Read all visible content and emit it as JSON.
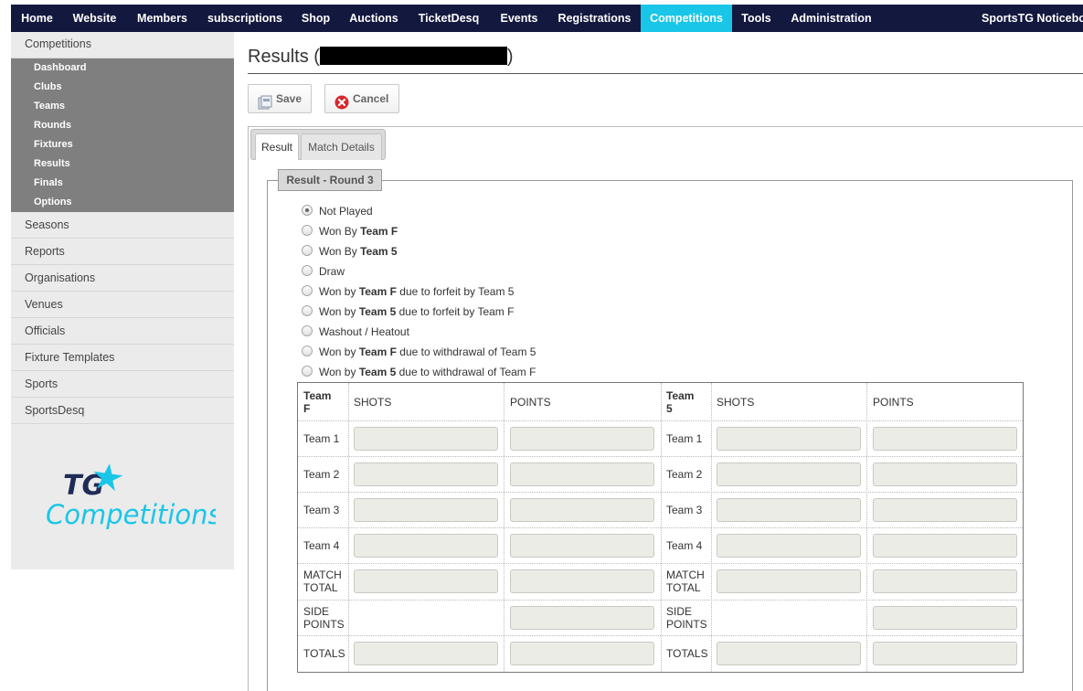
{
  "nav": {
    "items": [
      "Home",
      "Website",
      "Members",
      "subscriptions",
      "Shop",
      "Auctions",
      "TicketDesq",
      "Events",
      "Registrations",
      "Competitions",
      "Tools",
      "Administration"
    ],
    "active": "Competitions",
    "right_label": "SportsTG Noticeboard",
    "active_color": "#19c6e8",
    "bar_color": "#13183f"
  },
  "sidebar": {
    "section_title": "Competitions",
    "sub_items": [
      "Dashboard",
      "Clubs",
      "Teams",
      "Rounds",
      "Fixtures",
      "Results",
      "Finals",
      "Options"
    ],
    "items": [
      "Seasons",
      "Reports",
      "Organisations",
      "Venues",
      "Officials",
      "Fixture Templates",
      "Sports",
      "SportsDesq"
    ],
    "logo_line1": "TG",
    "logo_line2": "Competitions"
  },
  "page": {
    "title_prefix": "Results (",
    "title_suffix": ")",
    "save_label": "Save",
    "cancel_label": "Cancel"
  },
  "tabs": [
    "Result",
    "Match Details"
  ],
  "fieldset_legend": "Result - Round 3",
  "result_options": [
    {
      "pre": "Not Played",
      "team": "",
      "post": "",
      "checked": true
    },
    {
      "pre": "Won By ",
      "team": "Team F",
      "post": "",
      "checked": false
    },
    {
      "pre": "Won By ",
      "team": "Team 5",
      "post": "",
      "checked": false
    },
    {
      "pre": "Draw",
      "team": "",
      "post": "",
      "checked": false
    },
    {
      "pre": "Won by ",
      "team": "Team F",
      "post": " due to forfeit by Team 5",
      "checked": false
    },
    {
      "pre": "Won by ",
      "team": "Team 5",
      "post": " due to forfeit by Team F",
      "checked": false
    },
    {
      "pre": "Washout / Heatout",
      "team": "",
      "post": "",
      "checked": false
    },
    {
      "pre": "Won by ",
      "team": "Team F",
      "post": " due to withdrawal of Team 5",
      "checked": false
    },
    {
      "pre": "Won by ",
      "team": "Team 5",
      "post": " due to withdrawal of Team F",
      "checked": false
    }
  ],
  "score_table": {
    "home_team": "Team F",
    "away_team": "Team 5",
    "col_shots": "SHOTS",
    "col_points": "POINTS",
    "rows": [
      {
        "label": "Team 1",
        "shots": true
      },
      {
        "label": "Team 2",
        "shots": true
      },
      {
        "label": "Team 3",
        "shots": true
      },
      {
        "label": "Team 4",
        "shots": true
      },
      {
        "label": "MATCH TOTAL",
        "shots": true
      },
      {
        "label": "SIDE POINTS",
        "shots": false
      },
      {
        "label": "TOTALS",
        "shots": true
      }
    ]
  }
}
